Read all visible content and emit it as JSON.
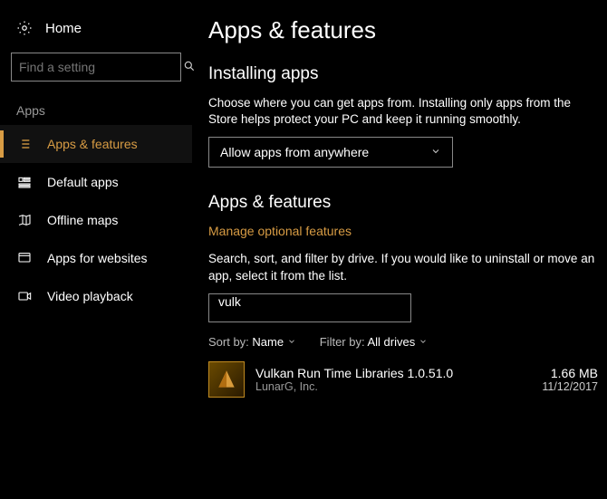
{
  "sidebar": {
    "home": "Home",
    "search_placeholder": "Find a setting",
    "category": "Apps",
    "items": [
      {
        "label": "Apps & features"
      },
      {
        "label": "Default apps"
      },
      {
        "label": "Offline maps"
      },
      {
        "label": "Apps for websites"
      },
      {
        "label": "Video playback"
      }
    ]
  },
  "main": {
    "title": "Apps & features",
    "install_heading": "Installing apps",
    "install_desc": "Choose where you can get apps from. Installing only apps from the Store helps protect your PC and keep it running smoothly.",
    "install_dropdown": "Allow apps from anywhere",
    "list_heading": "Apps & features",
    "optional_link": "Manage optional features",
    "list_desc": "Search, sort, and filter by drive. If you would like to uninstall or move an app, select it from the list.",
    "filter_value": "vulk",
    "sort_label": "Sort by:",
    "sort_value": "Name",
    "filter_label": "Filter by:",
    "filterby_value": "All drives",
    "app": {
      "name": "Vulkan Run Time Libraries 1.0.51.0",
      "publisher": "LunarG, Inc.",
      "size": "1.66 MB",
      "date": "11/12/2017"
    }
  }
}
